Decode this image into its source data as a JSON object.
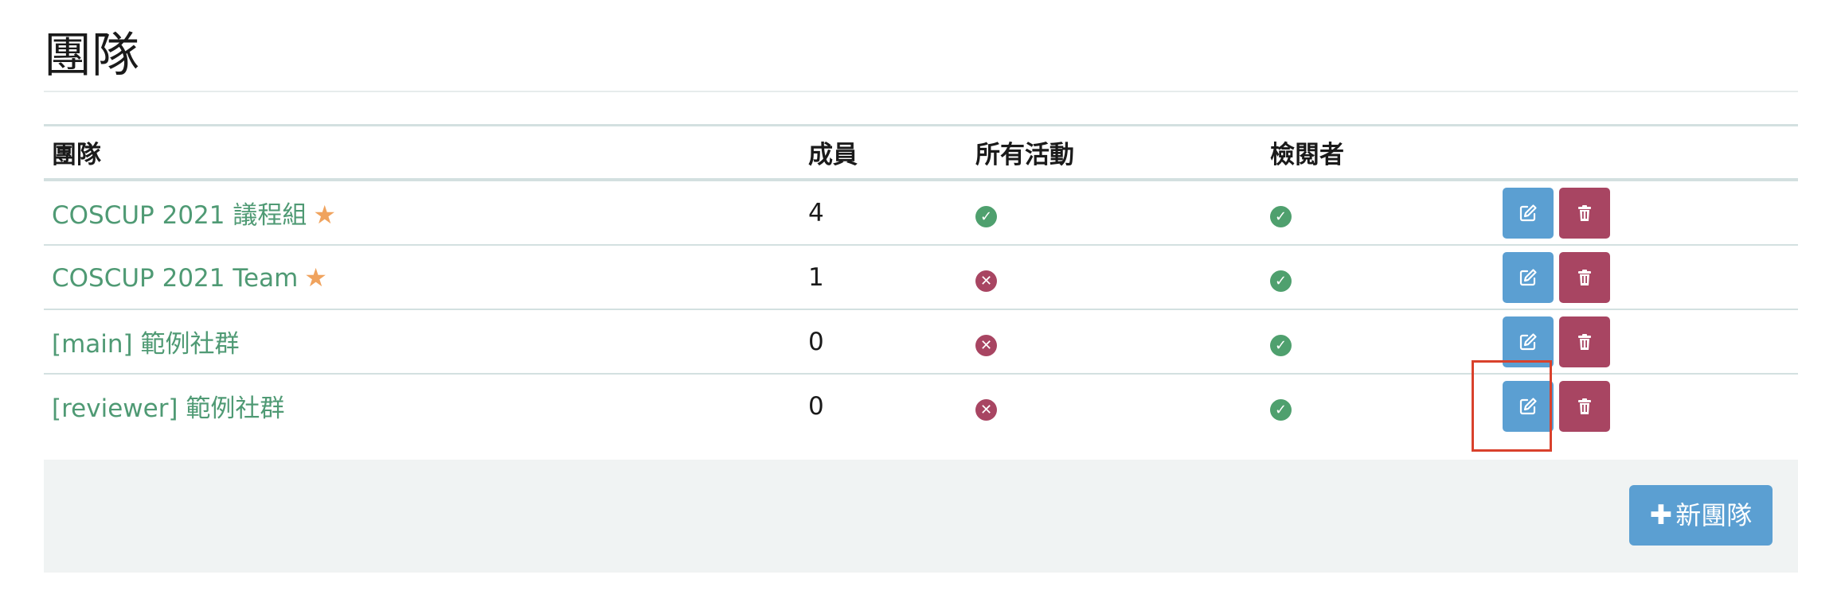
{
  "page_title": "團隊",
  "table": {
    "headers": {
      "team": "團隊",
      "members": "成員",
      "all_events": "所有活動",
      "reviewer": "檢閱者",
      "actions": ""
    },
    "rows": [
      {
        "name": "COSCUP 2021 議程組",
        "starred": true,
        "members": "4",
        "all_events": true,
        "reviewer": true
      },
      {
        "name": "COSCUP 2021 Team",
        "starred": true,
        "members": "1",
        "all_events": false,
        "reviewer": true
      },
      {
        "name": "[main] 範例社群",
        "starred": false,
        "members": "0",
        "all_events": false,
        "reviewer": true
      },
      {
        "name": "[reviewer] 範例社群",
        "starred": false,
        "members": "0",
        "all_events": false,
        "reviewer": true
      }
    ]
  },
  "icons": {
    "star": "star-icon",
    "check": "check-circle-icon",
    "cross": "x-circle-icon",
    "edit": "edit-icon",
    "delete": "trash-icon",
    "plus": "plus-icon"
  },
  "footer": {
    "new_team_label": "新團隊"
  },
  "colors": {
    "link": "#4f9a74",
    "star": "#f0a35e",
    "check": "#4fa06e",
    "cross": "#a84562",
    "edit_button": "#5b9fd2",
    "delete_button": "#a84562",
    "highlight": "#d9412c"
  }
}
